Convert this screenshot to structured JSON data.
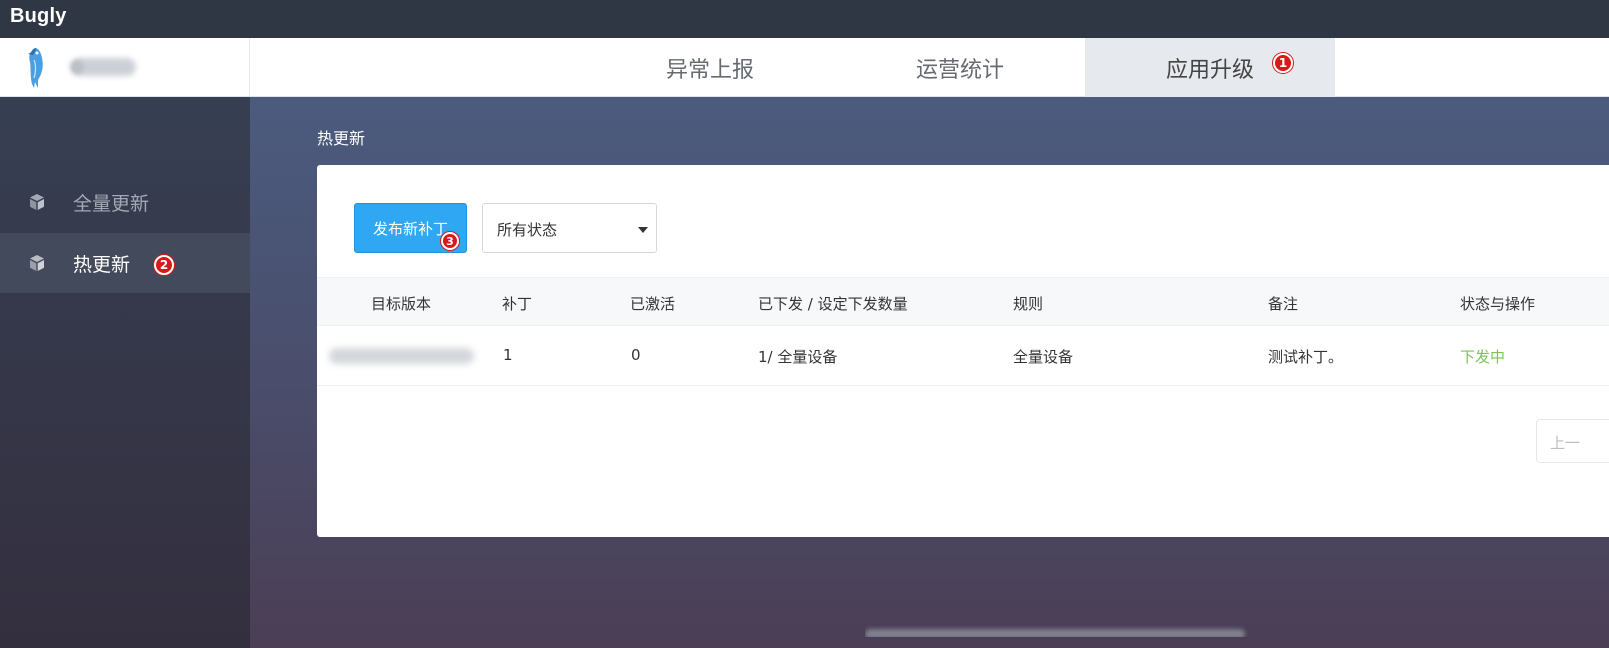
{
  "titlebar": {
    "brand": "Bugly"
  },
  "topnav": {
    "tabs": [
      {
        "label": "异常上报"
      },
      {
        "label": "运营统计"
      },
      {
        "label": "应用升级",
        "active": true,
        "badge": "1"
      }
    ]
  },
  "sidebar": {
    "items": [
      {
        "label": "全量更新",
        "icon": "cube-icon"
      },
      {
        "label": "热更新",
        "icon": "cube-icon",
        "active": true,
        "badge": "2"
      }
    ]
  },
  "main": {
    "section_title": "热更新",
    "toolbar": {
      "publish_label": "发布新补丁",
      "publish_badge": "3",
      "status_select_value": "所有状态"
    },
    "table": {
      "headers": [
        "目标版本",
        "补丁",
        "已激活",
        "已下发 / 设定下发数量",
        "规则",
        "备注",
        "状态与操作"
      ],
      "rows": [
        {
          "patch": "1",
          "activated": "0",
          "dispatched": "1/ 全量设备",
          "rule": "全量设备",
          "note": "测试补丁。",
          "status": "下发中"
        }
      ]
    },
    "pager": {
      "prev_label": "上一"
    }
  },
  "colors": {
    "primary": "#2fa7f2",
    "badge": "#d61a1a",
    "status_active": "#7cc35b",
    "titlebar": "#2f3744"
  }
}
